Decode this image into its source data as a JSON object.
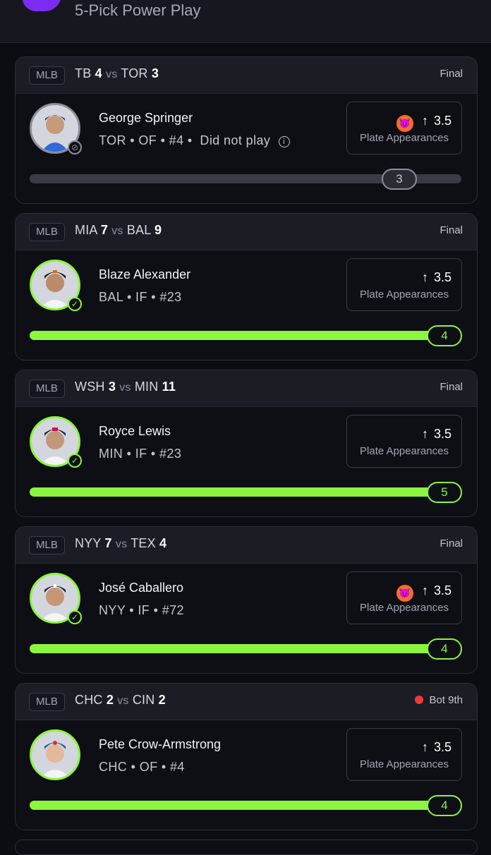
{
  "header": {
    "title": "5-Pick Power Play"
  },
  "cards": [
    {
      "league": "MLB",
      "away_team": "TB",
      "away_score": "4",
      "vs": "vs",
      "home_team": "TOR",
      "home_score": "3",
      "status": "Final",
      "player": "George Springer",
      "meta": "TOR • OF • #4 •",
      "meta_extra": "Did not play",
      "line": "3.5",
      "stat": "Plate Appearances",
      "result": "3",
      "progress": 0.0,
      "icon_devil": true
    },
    {
      "league": "MLB",
      "away_team": "MIA",
      "away_score": "7",
      "vs": "vs",
      "home_team": "BAL",
      "home_score": "9",
      "status": "Final",
      "player": "Blaze Alexander",
      "meta": "BAL • IF • #23",
      "line": "3.5",
      "stat": "Plate Appearances",
      "result": "4",
      "progress": 1.0
    },
    {
      "league": "MLB",
      "away_team": "WSH",
      "away_score": "3",
      "vs": "vs",
      "home_team": "MIN",
      "home_score": "11",
      "status": "Final",
      "player": "Royce Lewis",
      "meta": "MIN • IF • #23",
      "line": "3.5",
      "stat": "Plate Appearances",
      "result": "5",
      "progress": 1.0
    },
    {
      "league": "MLB",
      "away_team": "NYY",
      "away_score": "7",
      "vs": "vs",
      "home_team": "TEX",
      "home_score": "4",
      "status": "Final",
      "player": "José Caballero",
      "meta": "NYY • IF • #72",
      "line": "3.5",
      "stat": "Plate Appearances",
      "result": "4",
      "progress": 1.0,
      "icon_devil": true
    },
    {
      "league": "MLB",
      "away_team": "CHC",
      "away_score": "2",
      "vs": "vs",
      "home_team": "CIN",
      "home_score": "2",
      "status": "Bot 9th",
      "player": "Pete Crow-Armstrong",
      "meta": "CHC • OF • #4",
      "line": "3.5",
      "stat": "Plate Appearances",
      "result": "4",
      "progress": 1.0,
      "live": true
    }
  ],
  "colors": {
    "accent": "#8bf63d",
    "brand": "#7b2cf0",
    "live": "#f0383a"
  }
}
